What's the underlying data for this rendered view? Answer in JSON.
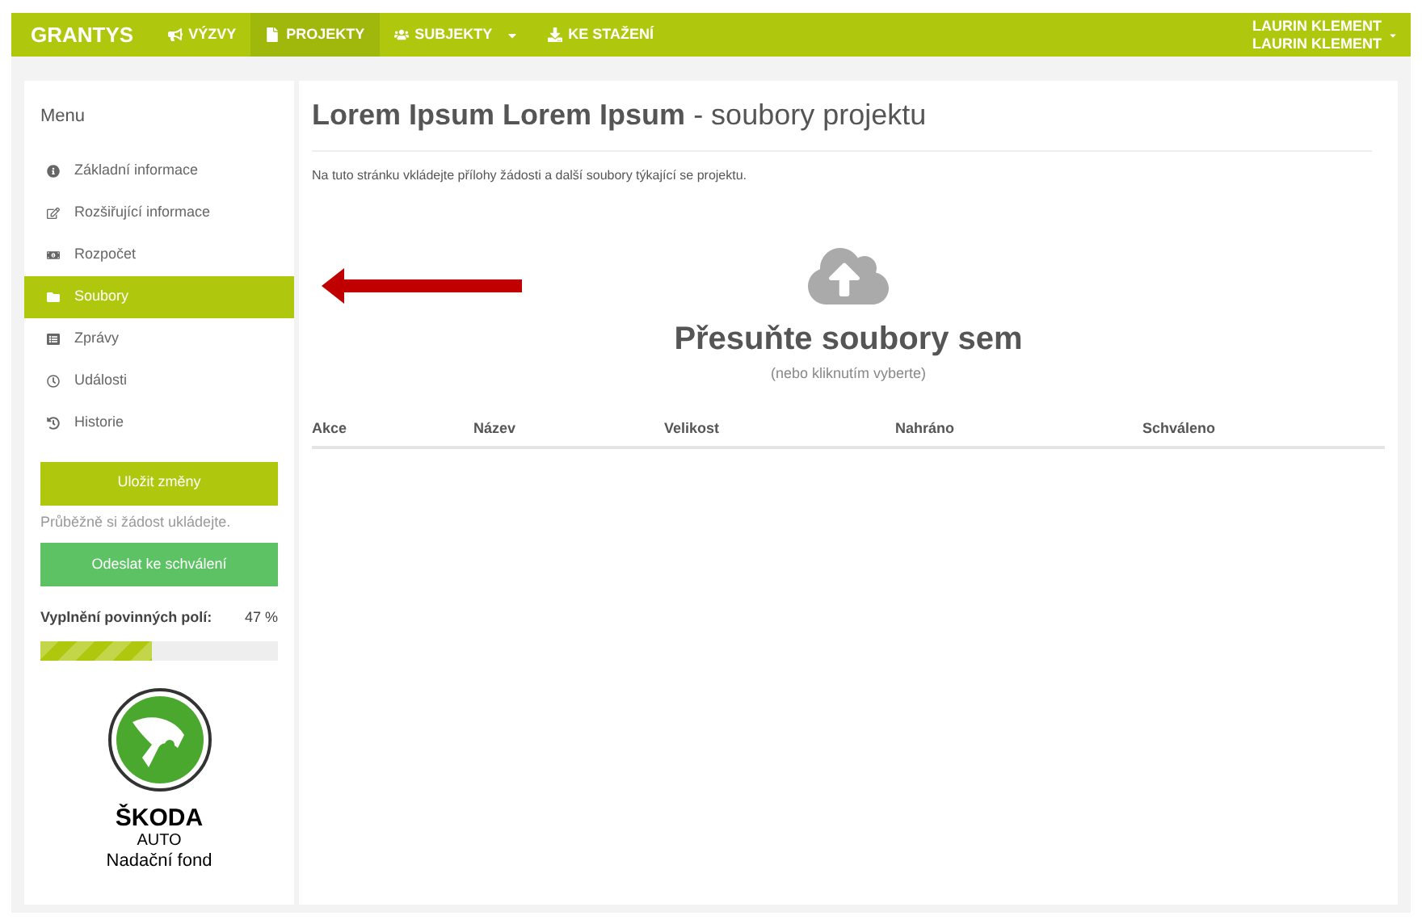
{
  "navbar": {
    "brand": "GRANTYS",
    "items": [
      {
        "label": "VÝZVY",
        "selected": false,
        "dropdown": false
      },
      {
        "label": "PROJEKTY",
        "selected": true,
        "dropdown": false
      },
      {
        "label": "SUBJEKTY",
        "selected": false,
        "dropdown": true
      },
      {
        "label": "KE STAŽENÍ",
        "selected": false,
        "dropdown": false
      }
    ],
    "user": [
      "LAURIN KLEMENT",
      "LAURIN KLEMENT"
    ]
  },
  "sidebar": {
    "title": "Menu",
    "items": [
      {
        "label": "Základní informace",
        "selected": false
      },
      {
        "label": "Rozšiřující informace",
        "selected": false
      },
      {
        "label": "Rozpočet",
        "selected": false
      },
      {
        "label": "Soubory",
        "selected": true
      },
      {
        "label": "Zprávy",
        "selected": false
      },
      {
        "label": "Události",
        "selected": false
      },
      {
        "label": "Historie",
        "selected": false
      }
    ],
    "save_button": "Uložit změny",
    "save_hint": "Průběžně si žádost ukládejte.",
    "submit_button": "Odeslat ke schválení",
    "progress": {
      "label": "Vyplnění povinných polí:",
      "reading": "47 %",
      "level": 0.47
    },
    "logo": {
      "brand": "ŠKODA",
      "sub": "AUTO",
      "org": "Nadační fond"
    }
  },
  "main": {
    "title_bold": "Lorem Ipsum Lorem Ipsum",
    "title_rest": "- soubory projektu",
    "intro": "Na tuto stránku vkládejte přílohy žádosti a další soubory týkající se projektu.",
    "dropzone": {
      "title": "Přesuňte soubory sem",
      "hint": "(nebo kliknutím vyberte)"
    },
    "table": {
      "columns": [
        "Akce",
        "Název",
        "Velikost",
        "Nahráno",
        "Schváleno"
      ]
    }
  }
}
